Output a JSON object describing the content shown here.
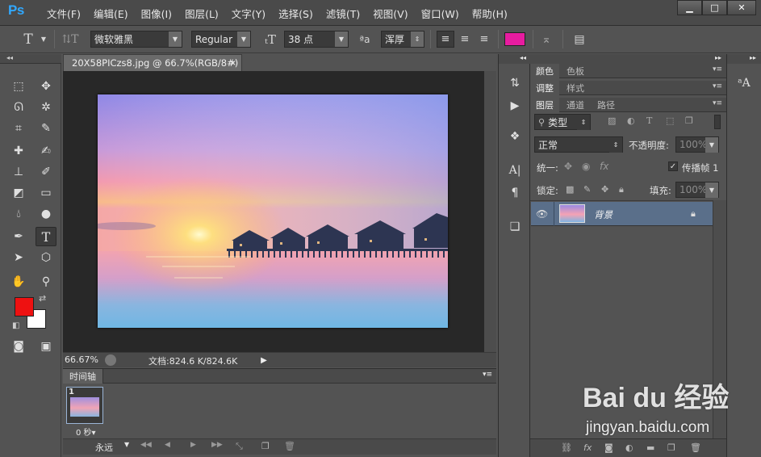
{
  "app": {
    "logo": "Ps",
    "menu": [
      "文件(F)",
      "编辑(E)",
      "图像(I)",
      "图层(L)",
      "文字(Y)",
      "选择(S)",
      "滤镜(T)",
      "视图(V)",
      "窗口(W)",
      "帮助(H)"
    ],
    "window_controls": {
      "minimize": "▁",
      "restore": "□",
      "close": "✕"
    }
  },
  "options_bar": {
    "font_family": "微软雅黑",
    "font_style": "Regular",
    "font_size": "38 点",
    "antialias": "浑厚",
    "color_swatch": "#e81ca0"
  },
  "document": {
    "tab_title": "20X58PICzs8.jpg @ 66.7%(RGB/8#)",
    "tab_close": "×",
    "zoom": "66.67%",
    "doc_info": "文档:824.6 K/824.6K"
  },
  "tool_colors": {
    "foreground": "#ee1111",
    "background": "#ffffff"
  },
  "timeline": {
    "tab_label": "时间轴",
    "frame_number": "1",
    "frame_delay": "0 秒▾",
    "loop": "永远"
  },
  "panels": {
    "group1_tabs": [
      "颜色",
      "色板"
    ],
    "group2_tabs": [
      "调整",
      "样式"
    ],
    "group3_tabs": [
      "图层",
      "通道",
      "路径"
    ],
    "filter_kind": "类型",
    "blend_mode": "正常",
    "opacity_label": "不透明度:",
    "opacity_value": "100%",
    "unify_label": "统一:",
    "propagate_label": "传播帧 1",
    "lock_label": "锁定:",
    "fill_label": "填充:",
    "fill_value": "100%",
    "layer_name": "背景"
  },
  "watermark": {
    "brand": "Bai du 经验",
    "url": "jingyan.baidu.com"
  }
}
